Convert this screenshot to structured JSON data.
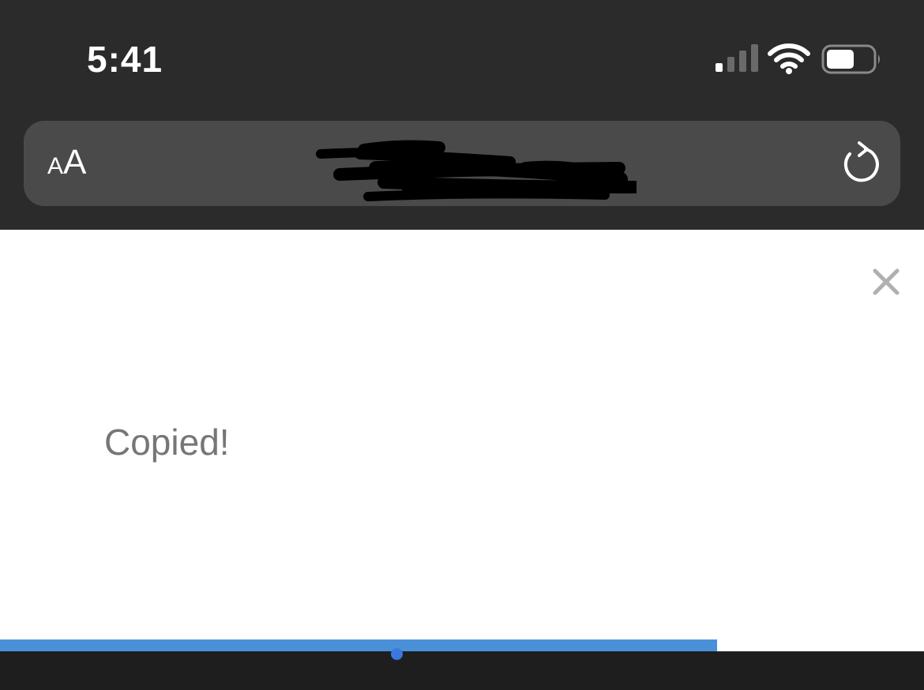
{
  "status_bar": {
    "time": "5:41",
    "signal_icon": "cellular-signal-icon",
    "wifi_icon": "wifi-icon",
    "battery_icon": "battery-icon",
    "battery_level": 0.6
  },
  "address_bar": {
    "reader_label_small": "A",
    "reader_label_big": "A",
    "url_redacted": true,
    "reload_icon": "reload-icon"
  },
  "page": {
    "close_icon": "close-icon",
    "message": "Copied!",
    "progress": 0.776
  },
  "colors": {
    "chrome_bg": "#2b2b2b",
    "address_bg": "#4a4a4a",
    "page_bg": "#ffffff",
    "message_text": "#767676",
    "progress_blue": "#4a90d9",
    "dot_blue": "#3a78e0"
  }
}
